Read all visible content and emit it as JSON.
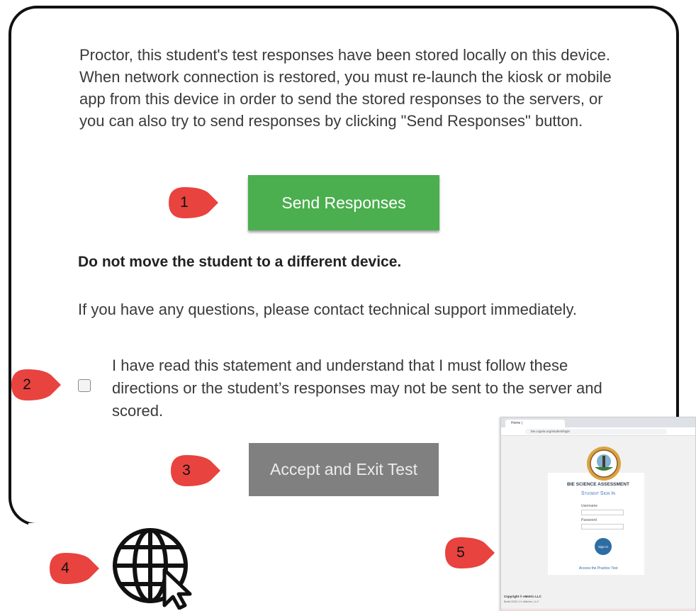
{
  "dialog": {
    "message": "Proctor, this student's test responses have been stored locally on this device. When network connection is restored, you must re-launch the kiosk or mobile app from this device in order to send the stored responses to the servers, or you can also try to send responses by clicking \"Send Responses\" button.",
    "send_button_label": "Send Responses",
    "warning": "Do not move the student to a different device.",
    "contact": "If you have any questions, please contact technical support immediately.",
    "acknowledgement": "I have read this statement and understand that I must follow these directions or the student’s responses may not be sent to the server and scored.",
    "acknowledgement_checked": false,
    "exit_button_label": "Accept and Exit Test"
  },
  "callouts": [
    "1",
    "2",
    "3",
    "4",
    "5"
  ],
  "icons": {
    "web_icon": "globe-cursor-icon"
  },
  "thumbnail": {
    "tab_title": "Home | ",
    "url": "bie.cognia.org/student/login",
    "title": "BIE SCIENCE ASSESSMENT",
    "subtitle": "Student Sign In",
    "username_label": "Username",
    "password_label": "Password",
    "signin_label": "Sign In",
    "practice_link": "Access the Practice Test",
    "copyright": "Copyright © eMetric LLC",
    "copyright_sub": "Build 2022.1.0 eMetric, LLC"
  },
  "colors": {
    "send_button": "#4bae4f",
    "exit_button": "#808080",
    "callout": "#e8433f"
  }
}
